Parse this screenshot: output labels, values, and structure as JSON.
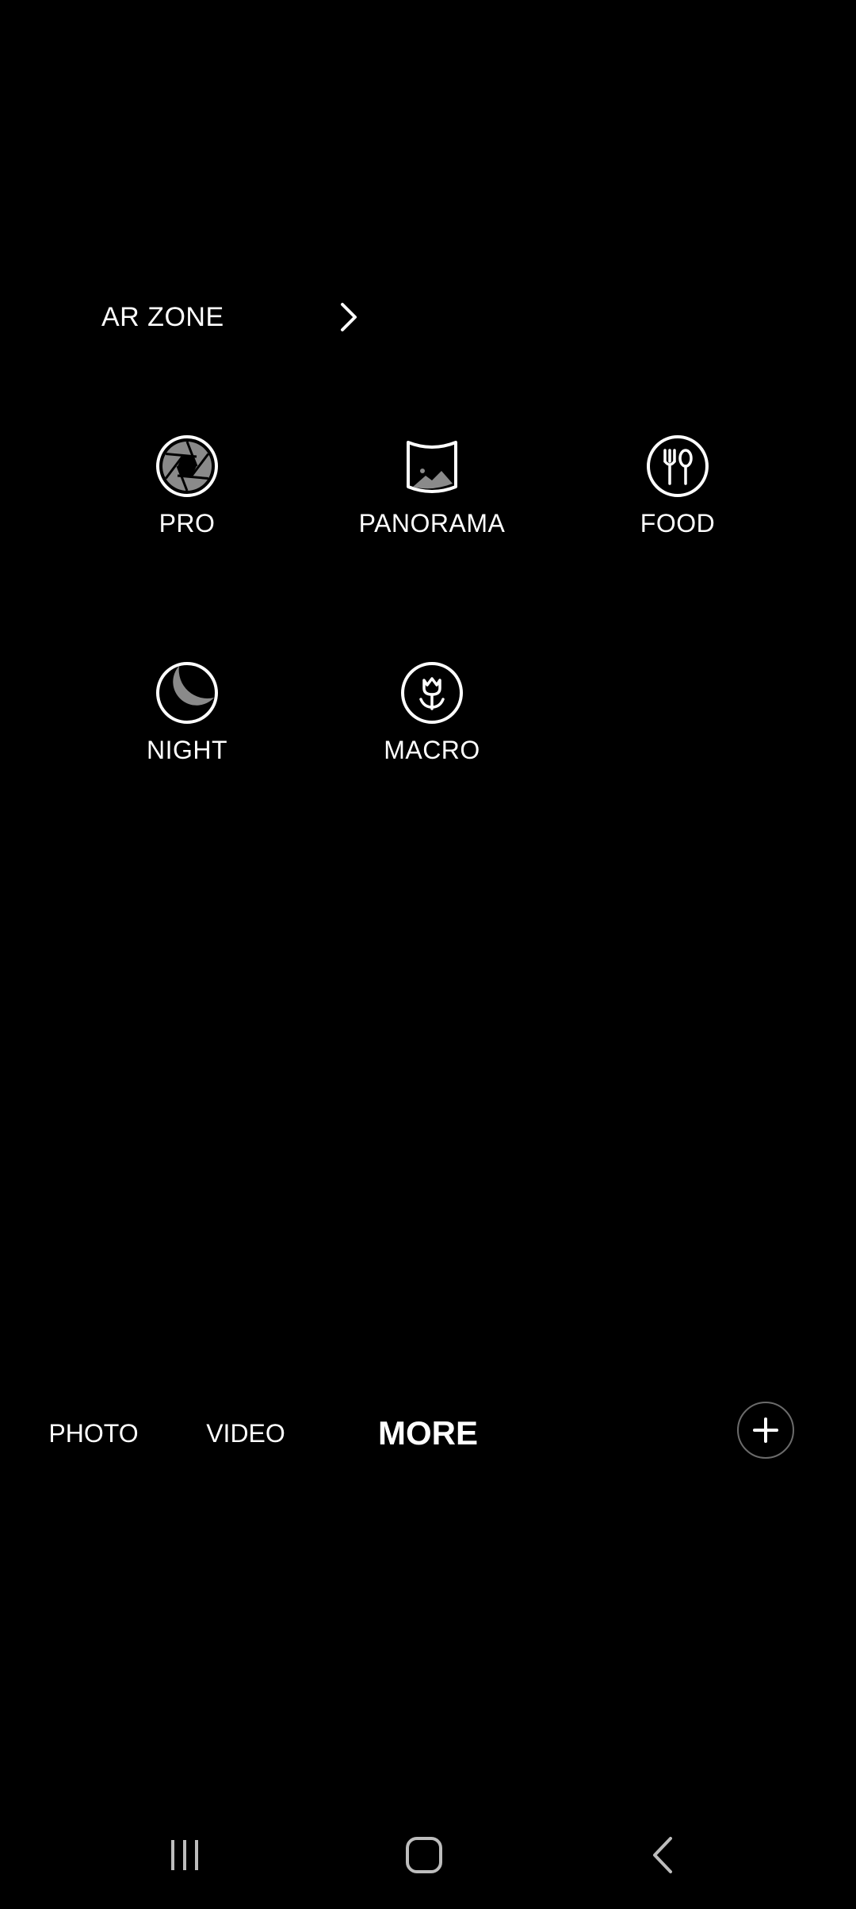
{
  "ar_zone": {
    "label": "AR ZONE",
    "icon": "chevron-right-icon"
  },
  "modes": [
    {
      "label": "PRO",
      "icon": "aperture-icon"
    },
    {
      "label": "PANORAMA",
      "icon": "panorama-icon"
    },
    {
      "label": "FOOD",
      "icon": "fork-spoon-icon"
    },
    {
      "label": "NIGHT",
      "icon": "moon-icon"
    },
    {
      "label": "MACRO",
      "icon": "flower-icon"
    }
  ],
  "tabs": [
    {
      "label": "PHOTO",
      "active": false
    },
    {
      "label": "VIDEO",
      "active": false
    },
    {
      "label": "MORE",
      "active": true
    }
  ],
  "add_button": {
    "icon": "plus-icon"
  },
  "nav_bar": {
    "recents": "recents-icon",
    "home": "home-icon",
    "back": "back-icon"
  },
  "colors": {
    "background": "#000000",
    "text": "#ffffff",
    "icon_gray": "#8a8a8a"
  }
}
